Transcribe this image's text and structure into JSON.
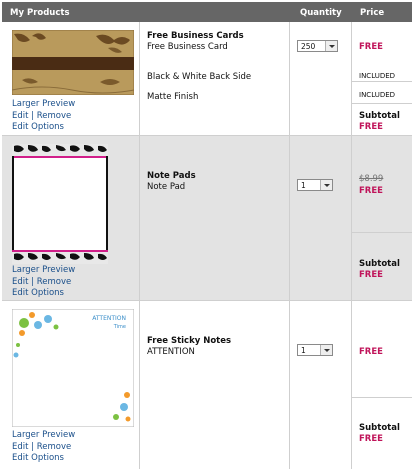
{
  "header": {
    "products": "My Products",
    "quantity": "Quantity",
    "price": "Price"
  },
  "links": {
    "preview": "Larger Preview",
    "edit": "Edit",
    "sep": " | ",
    "remove": "Remove",
    "options": "Edit Options"
  },
  "subtotal_label": "Subtotal",
  "items": [
    {
      "title": "Free Business Cards",
      "subtitle": "Free Business Card",
      "options": [
        "Black & White Back Side",
        "Matte Finish"
      ],
      "quantity": "250",
      "price": "FREE",
      "option_prices": [
        "INCLUDED",
        "INCLUDED"
      ],
      "subtotal": "FREE"
    },
    {
      "title": "Note Pads",
      "subtitle": "Note Pad",
      "quantity": "1",
      "original_price": "$8.99",
      "price": "FREE",
      "subtotal": "FREE"
    },
    {
      "title": "Free Sticky Notes",
      "subtitle": "ATTENTION",
      "quantity": "1",
      "price": "FREE",
      "subtotal": "FREE",
      "thumb_text": {
        "line1": "ATTENTION",
        "line2": "Time"
      }
    }
  ],
  "colors": {
    "header_bg": "#666666",
    "price": "#c0145a",
    "link": "#1a4f8a",
    "alt_row": "#e3e3e3"
  }
}
